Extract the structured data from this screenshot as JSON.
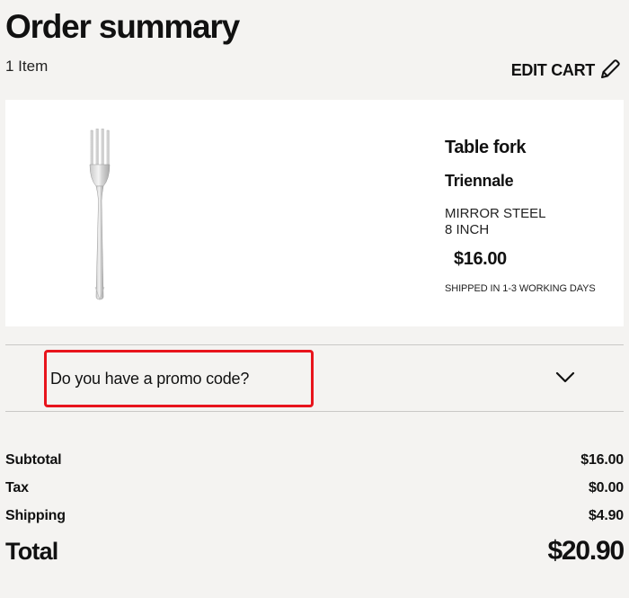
{
  "header": {
    "title": "Order summary",
    "item_count": "1 Item",
    "edit_cart_label": "EDIT CART"
  },
  "product": {
    "name": "Table fork",
    "line": "Triennale",
    "finish": "MIRROR STEEL",
    "size": "8 INCH",
    "price": "$16.00",
    "shipping_note": "SHIPPED IN 1-3 WORKING DAYS",
    "image_icon": "fork-image"
  },
  "promo": {
    "label": "Do you have a promo code?",
    "expand_icon": "chevron-down-icon",
    "highlight_color": "#e8141c"
  },
  "totals": {
    "rows": [
      {
        "label": "Subtotal",
        "value": "$16.00"
      },
      {
        "label": "Tax",
        "value": "$0.00"
      },
      {
        "label": "Shipping",
        "value": "$4.90"
      }
    ],
    "total_label": "Total",
    "total_value": "$20.90"
  },
  "colors": {
    "background": "#f4f3f1",
    "card": "#ffffff",
    "text": "#111111",
    "divider": "#c9c8c6"
  }
}
